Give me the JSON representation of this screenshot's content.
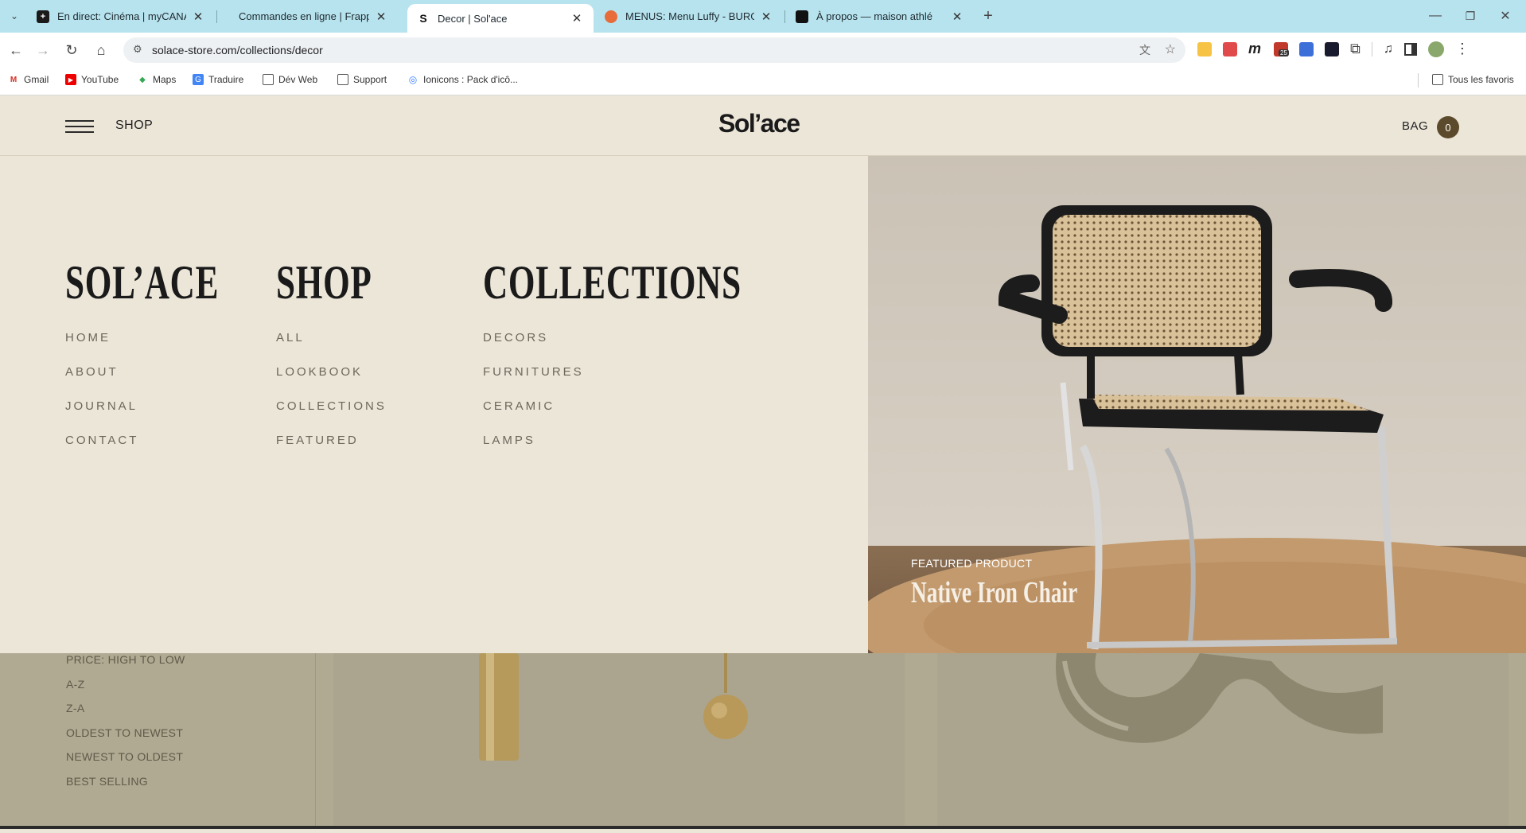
{
  "browser": {
    "tabs": [
      {
        "title": "En direct: Cinéma | myCANAL",
        "fav_color": "#1a1a1a",
        "fav_glyph": "+"
      },
      {
        "title": "Commandes en ligne | Frappe E",
        "fav_color": "#b7e3ee",
        "fav_glyph": ""
      },
      {
        "title": "Decor | Sol'ace",
        "fav_color": "#fff",
        "fav_glyph": "S"
      },
      {
        "title": "MENUS: Menu Luffy - BURGER",
        "fav_color": "#e86b3a",
        "fav_glyph": ""
      },
      {
        "title": "À propos — maison athlé",
        "fav_color": "#111",
        "fav_glyph": ""
      }
    ],
    "url": "solace-store.com/collections/decor",
    "bookmarks": [
      {
        "label": "Gmail",
        "icon": "gmail-icon"
      },
      {
        "label": "YouTube",
        "icon": "youtube-icon"
      },
      {
        "label": "Maps",
        "icon": "maps-icon"
      },
      {
        "label": "Traduire",
        "icon": "translate-icon"
      },
      {
        "label": "Dév Web",
        "icon": "folder-icon"
      },
      {
        "label": "Support",
        "icon": "folder-icon"
      },
      {
        "label": "Ionicons : Pack d'icô...",
        "icon": "ionicons-icon"
      }
    ],
    "all_bookmarks": "Tous les favoris",
    "extension_badge": "25"
  },
  "header": {
    "shop": "SHOP",
    "logo": "Sol’ace",
    "bag": "BAG",
    "bag_count": "0"
  },
  "menu": {
    "columns": [
      {
        "heading": "SOL’ACE",
        "links": [
          "HOME",
          "ABOUT",
          "JOURNAL",
          "CONTACT"
        ]
      },
      {
        "heading": "SHOP",
        "links": [
          "ALL",
          "LOOKBOOK",
          "COLLECTIONS",
          "FEATURED"
        ]
      },
      {
        "heading": "COLLECTIONS",
        "links": [
          "DECORS",
          "FURNITURES",
          "CERAMIC",
          "LAMPS"
        ]
      }
    ]
  },
  "featured": {
    "label": "FEATURED PRODUCT",
    "title": "Native Iron Chair"
  },
  "sort_options": [
    "PRICE: HIGH TO LOW",
    "A-Z",
    "Z-A",
    "OLDEST TO NEWEST",
    "NEWEST TO OLDEST",
    "BEST SELLING"
  ]
}
